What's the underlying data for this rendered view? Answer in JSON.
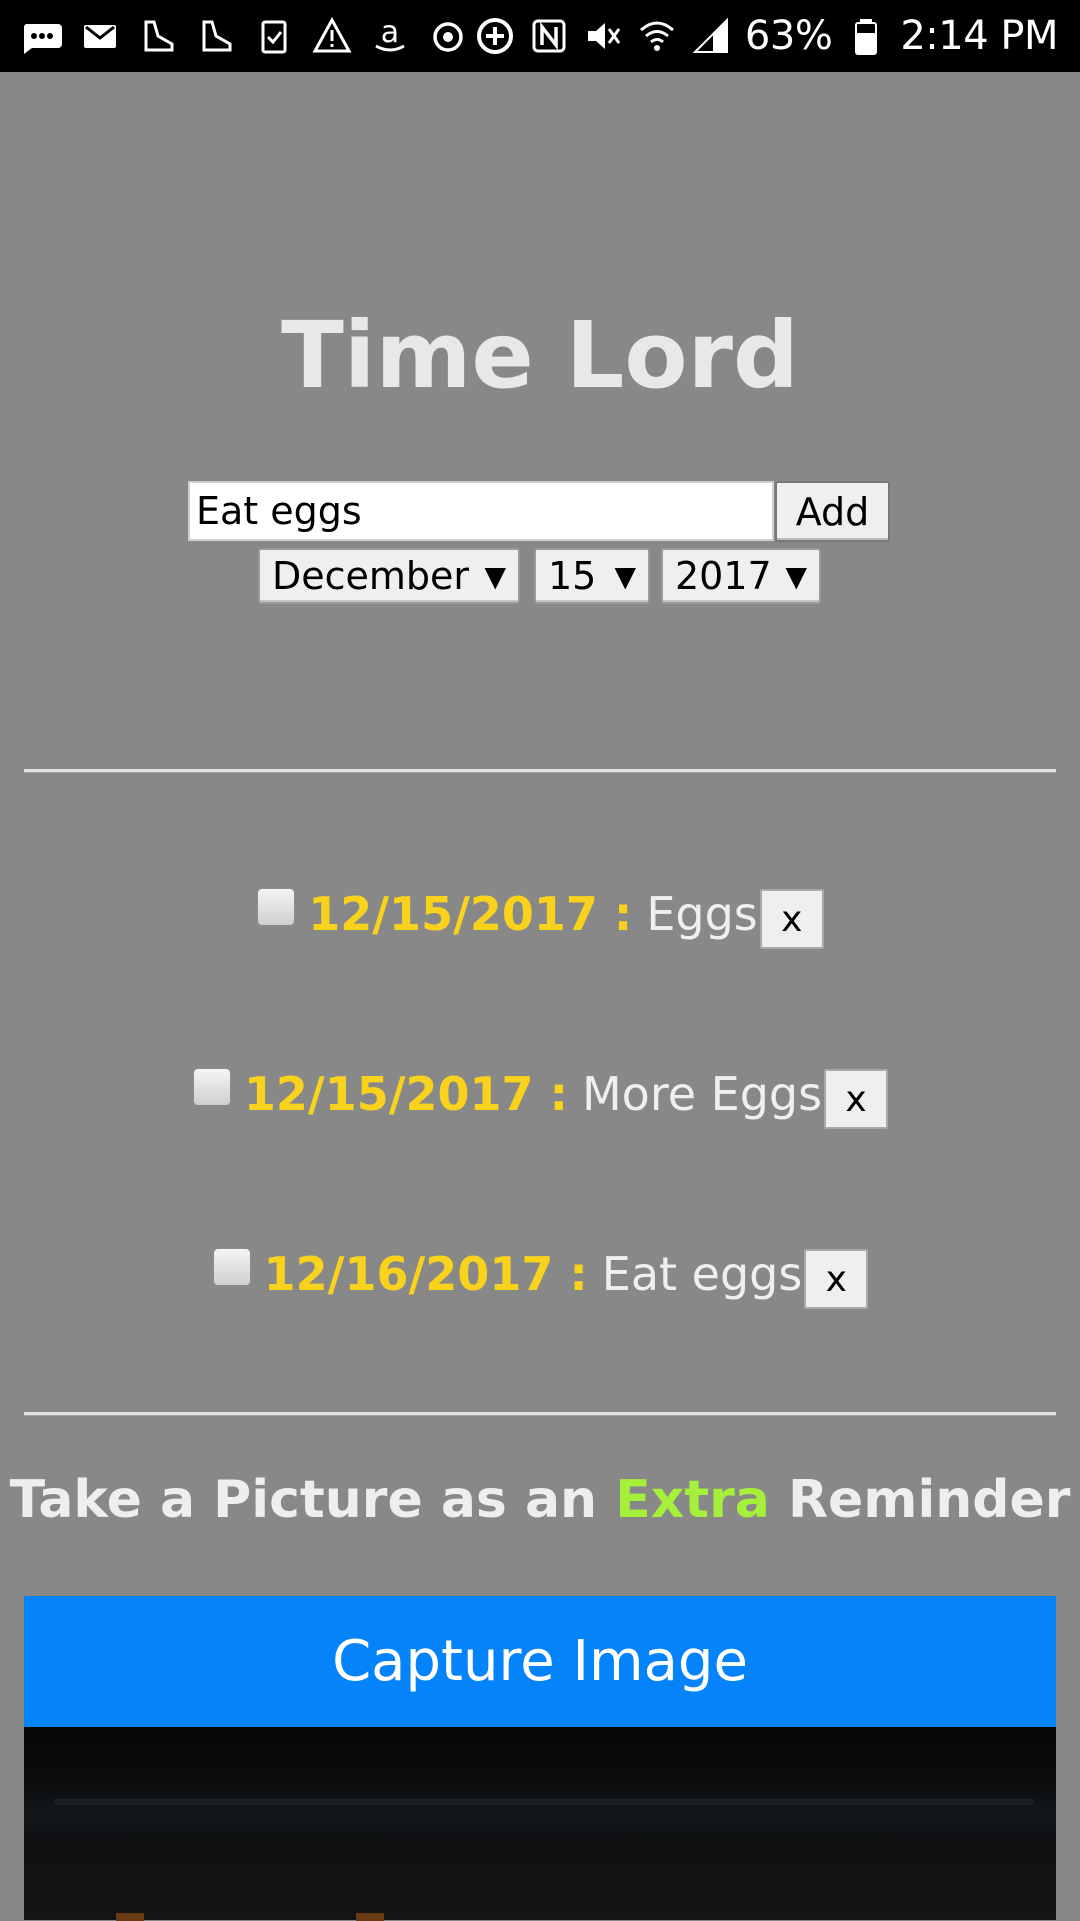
{
  "status_bar": {
    "battery": "63%",
    "time": "2:14 PM",
    "left_icons": [
      "chat-icon",
      "mail-icon",
      "shoe-icon",
      "shoe-icon",
      "clipboard-check-icon",
      "warning-icon",
      "amazon-icon",
      "power-icon"
    ],
    "right_icons": [
      "plus-circle-icon",
      "nfc-icon",
      "mute-icon",
      "wifi-icon",
      "signal-icon",
      "battery-icon"
    ]
  },
  "app": {
    "title": "Time Lord"
  },
  "form": {
    "task_value": "Eat eggs",
    "add_label": "Add",
    "month": "December",
    "day": "15",
    "year": "2017"
  },
  "reminders": [
    {
      "date": "12/15/2017 :",
      "text": "Eggs",
      "delete_label": "x",
      "checked": false
    },
    {
      "date": "12/15/2017 :",
      "text": "More Eggs",
      "delete_label": "x",
      "checked": false
    },
    {
      "date": "12/16/2017 :",
      "text": "Eat eggs",
      "delete_label": "x",
      "checked": false
    }
  ],
  "photo": {
    "heading_before": "Take a Picture as an",
    "heading_accent": "Extra",
    "heading_after": "Reminder",
    "capture_label": "Capture Image"
  },
  "colors": {
    "background": "#888888",
    "date_yellow": "#f9d21e",
    "accent_green": "#a6f03c",
    "capture_blue": "#0483fb"
  }
}
